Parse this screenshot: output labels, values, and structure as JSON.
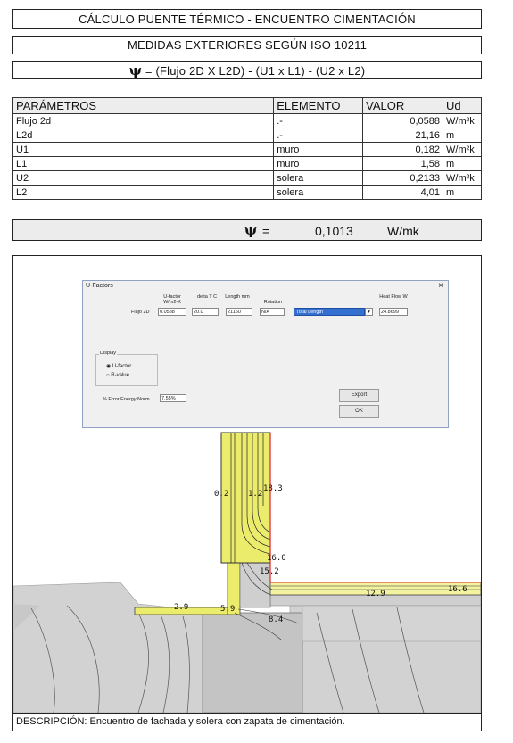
{
  "header": {
    "title": "CÁLCULO PUENTE TÉRMICO - ENCUENTRO CIMENTACIÓN",
    "subtitle": "MEDIDAS EXTERIORES SEGÚN ISO 10211",
    "formula_symbol": "ψ",
    "formula_text": "= (Flujo 2D X L2D) - (U1 x L1) - (U2 x L2)"
  },
  "params": {
    "headers": [
      "PARÁMETROS",
      "ELEMENTO",
      "VALOR",
      "Ud"
    ],
    "rows": [
      {
        "param": "Flujo 2d",
        "element": ".-",
        "value": "0,0588",
        "unit": "W/m²k"
      },
      {
        "param": "L2d",
        "element": ".-",
        "value": "21,16",
        "unit": "m"
      },
      {
        "param": "U1",
        "element": "muro",
        "value": "0,182",
        "unit": "W/m²k"
      },
      {
        "param": "L1",
        "element": "muro",
        "value": "1,58",
        "unit": "m"
      },
      {
        "param": "U2",
        "element": "solera",
        "value": "0,2133",
        "unit": "W/m²k"
      },
      {
        "param": "L2",
        "element": "solera",
        "value": "4,01",
        "unit": "m"
      }
    ]
  },
  "result": {
    "symbol": "ψ",
    "equals": "=",
    "value": "0,1013",
    "unit": "W/mk"
  },
  "dialog": {
    "title": "U-Factors",
    "col_ufactor": "U-factor W/m2-K",
    "col_deltat": "delta T C",
    "col_length": "Length mm",
    "col_rotation": "Rotation",
    "col_heatflow": "Heat Flow W",
    "row_label": "Flujo 2D",
    "ufactor": "0.0588",
    "deltat": "20.0",
    "length": "21160",
    "rotation": "N/A",
    "length_mode": "Total Length",
    "heatflow": "24.8699",
    "display_label": "Display",
    "radio_ufactor": "U-factor",
    "radio_rvalue": "R-value",
    "error_label": "% Error Energy Norm",
    "error_value": "7.55%",
    "export_label": "Export",
    "ok_label": "OK"
  },
  "figure_labels": [
    "0.2",
    "1.2",
    "18.3",
    "16.0",
    "15.2",
    "12.9",
    "16.6",
    "2.9",
    "5.9",
    "8.4"
  ],
  "description": "DESCRIPCIÓN: Encuentro de fachada y solera con zapata de cimentación."
}
